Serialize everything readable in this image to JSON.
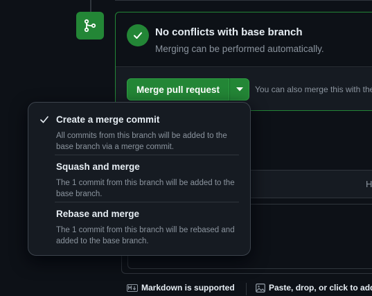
{
  "status": {
    "title": "No conflicts with base branch",
    "subtitle": "Merging can be performed automatically."
  },
  "actions": {
    "merge_label": "Merge pull request",
    "also_text": "You can also merge this with the"
  },
  "menu": {
    "items": [
      {
        "title": "Create a merge commit",
        "desc": "All commits from this branch will be added to the base branch via a merge commit.",
        "selected": true
      },
      {
        "title": "Squash and merge",
        "desc": "The 1 commit from this branch will be added to the base branch.",
        "selected": false
      },
      {
        "title": "Rebase and merge",
        "desc": "The 1 commit from this branch will be rebased and added to the base branch.",
        "selected": false
      }
    ]
  },
  "comment": {
    "tab_partial": "H"
  },
  "footer": {
    "markdown": "Markdown is supported",
    "paste": "Paste, drop, or click to add f"
  },
  "colors": {
    "accent_green": "#238636",
    "background": "#0d1117",
    "muted_text": "#8b949e"
  }
}
